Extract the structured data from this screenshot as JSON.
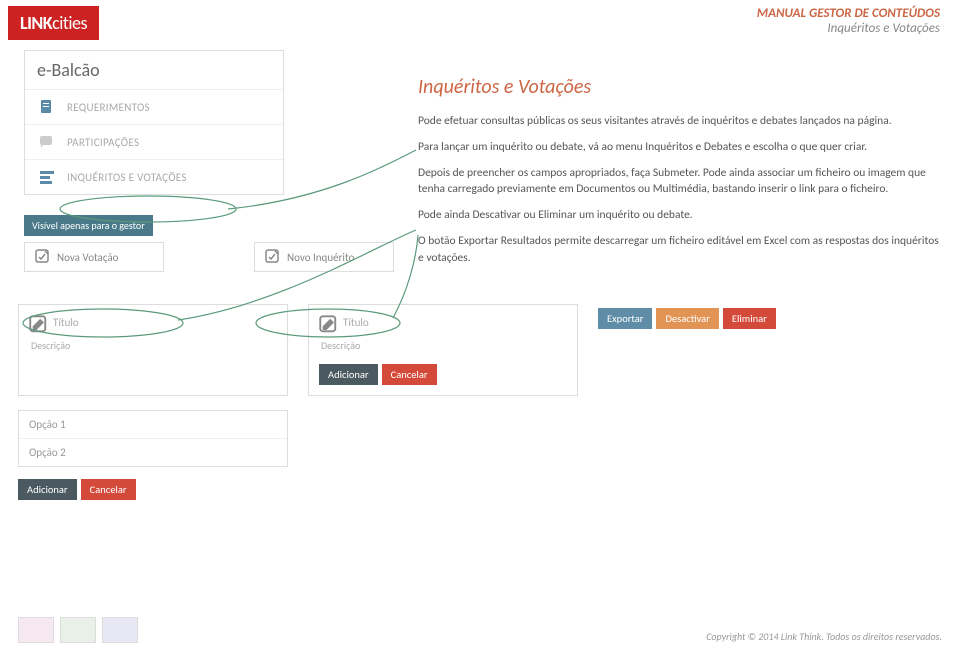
{
  "header": {
    "logo_a": "LINK",
    "logo_b": "cities",
    "title": "MANUAL GESTOR DE CONTEÚDOS",
    "subtitle": "Inquéritos e Votações"
  },
  "sidebar": {
    "heading": "e-Balcão",
    "items": [
      "REQUERIMENTOS",
      "PARTICIPAÇÕES",
      "INQUÉRITOS E VOTAÇÕES"
    ]
  },
  "gestor_badge": "Visível apenas para o gestor",
  "create": {
    "votacao": "Nova Votação",
    "inquerito": "Novo Inquérito"
  },
  "article": {
    "title": "Inquéritos e Votações",
    "p1": "Pode efetuar consultas públicas os seus visitantes através de inquéritos e debates lançados na página.",
    "p2": "Para lançar um inquérito ou debate, vá ao menu Inquéritos e Debates e escolha o que quer criar.",
    "p3": "Depois de preencher os campos apropriados, faça Submeter. Pode ainda associar um ficheiro ou imagem que tenha carregado previamente em Documentos ou Multimédia, bastando inserir o link para o ficheiro.",
    "p4": "Pode ainda Descativar ou Eliminar um inquérito ou debate.",
    "p5": "O botão Exportar Resultados permite descarregar um ficheiro editável em Excel com as respostas dos inquéritos e votações."
  },
  "form": {
    "titulo": "Título",
    "descricao": "Descrição",
    "opcao1": "Opção 1",
    "opcao2": "Opção 2"
  },
  "buttons": {
    "exportar": "Exportar",
    "desactivar": "Desactivar",
    "eliminar": "Eliminar",
    "adicionar": "Adicionar",
    "cancelar": "Cancelar"
  },
  "footer": {
    "copyright": "Copyright © 2014 Link Think. Todos os direitos reservados."
  }
}
